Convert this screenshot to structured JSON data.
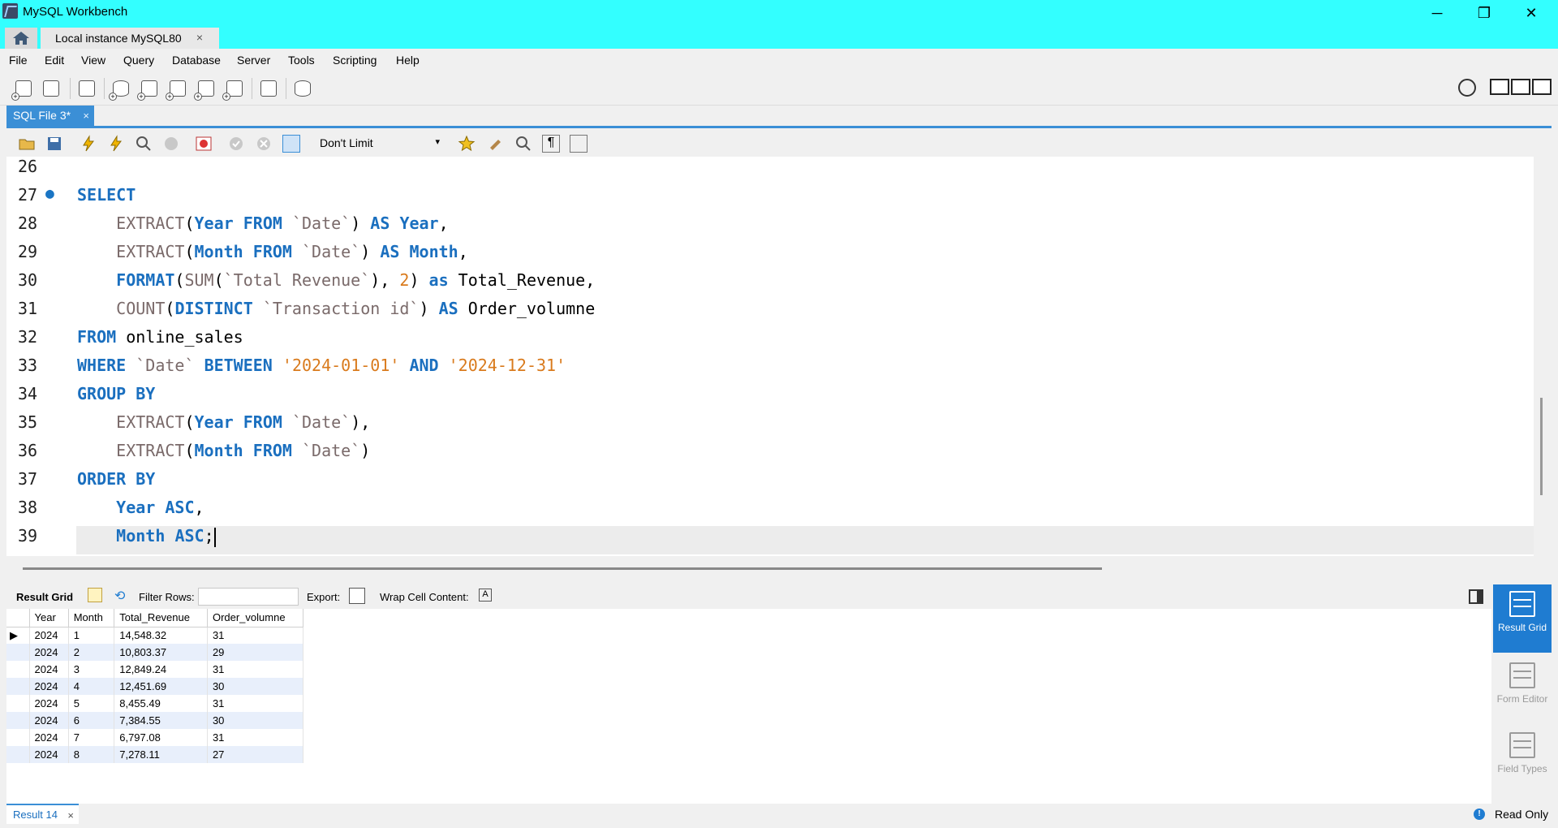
{
  "window": {
    "title": "MySQL Workbench",
    "minimize": "─",
    "maximize": "❐",
    "close": "✕"
  },
  "connection_tab": {
    "label": "Local instance MySQL80",
    "close": "×"
  },
  "menu": [
    "File",
    "Edit",
    "View",
    "Query",
    "Database",
    "Server",
    "Tools",
    "Scripting",
    "Help"
  ],
  "sql_tab": {
    "label": "SQL File 3*",
    "close": "×"
  },
  "sql_toolbar": {
    "limit": "Don't Limit",
    "caret": "▾"
  },
  "editor": {
    "lines": [
      {
        "n": "26",
        "code": ""
      },
      {
        "n": "27",
        "code": "SELECT"
      },
      {
        "n": "28",
        "code": "    EXTRACT(Year FROM `Date`) AS Year,"
      },
      {
        "n": "29",
        "code": "    EXTRACT(Month FROM `Date`) AS Month,"
      },
      {
        "n": "30",
        "code": "    FORMAT(SUM(`Total Revenue`), 2) as Total_Revenue,"
      },
      {
        "n": "31",
        "code": "    COUNT(DISTINCT `Transaction id`) AS Order_volumne"
      },
      {
        "n": "32",
        "code": "FROM online_sales"
      },
      {
        "n": "33",
        "code": "WHERE `Date` BETWEEN '2024-01-01' AND '2024-12-31'"
      },
      {
        "n": "34",
        "code": "GROUP BY"
      },
      {
        "n": "35",
        "code": "    EXTRACT(Year FROM `Date`),"
      },
      {
        "n": "36",
        "code": "    EXTRACT(Month FROM `Date`)"
      },
      {
        "n": "37",
        "code": "ORDER BY"
      },
      {
        "n": "38",
        "code": "    Year ASC,"
      },
      {
        "n": "39",
        "code": "    Month ASC;"
      }
    ]
  },
  "result_toolbar": {
    "result_grid": "Result Grid",
    "filter_rows": "Filter Rows:",
    "export": "Export:",
    "wrap": "Wrap Cell Content:"
  },
  "result_grid": {
    "columns": [
      "Year",
      "Month",
      "Total_Revenue",
      "Order_volumne"
    ],
    "rows": [
      [
        "2024",
        "1",
        "14,548.32",
        "31"
      ],
      [
        "2024",
        "2",
        "10,803.37",
        "29"
      ],
      [
        "2024",
        "3",
        "12,849.24",
        "31"
      ],
      [
        "2024",
        "4",
        "12,451.69",
        "30"
      ],
      [
        "2024",
        "5",
        "8,455.49",
        "31"
      ],
      [
        "2024",
        "6",
        "7,384.55",
        "30"
      ],
      [
        "2024",
        "7",
        "6,797.08",
        "31"
      ],
      [
        "2024",
        "8",
        "7,278.11",
        "27"
      ]
    ]
  },
  "side_panel": {
    "result_grid": "Result Grid",
    "form_editor": "Form Editor",
    "field_types": "Field Types"
  },
  "bottom": {
    "result_tab": "Result 14",
    "close": "×",
    "status": "Read Only"
  },
  "colors": {
    "title_bar": "#33ffff",
    "accent": "#3b8fd6",
    "keyword": "#1a6fbf",
    "string": "#d97a1c"
  }
}
